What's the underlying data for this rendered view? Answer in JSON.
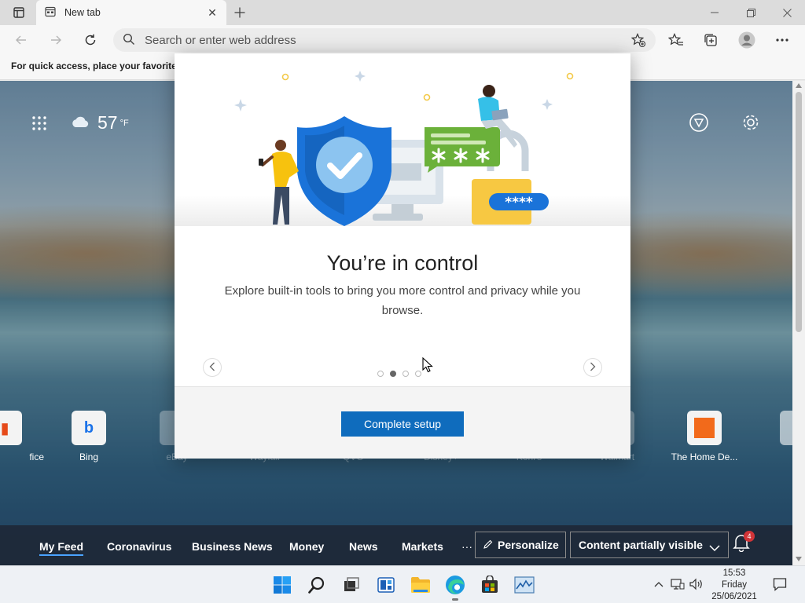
{
  "tab": {
    "title": "New tab"
  },
  "address": {
    "placeholder": "Search or enter web address"
  },
  "favorites_bar": {
    "text": "For quick access, place your favorites h"
  },
  "ntp": {
    "weather": {
      "temp": "57",
      "unit": "°F"
    },
    "quick_links": [
      {
        "label": "fice",
        "icon": "office-icon"
      },
      {
        "label": "Bing",
        "icon": "bing-icon"
      },
      {
        "label": "eBay",
        "icon": "ebay-icon"
      },
      {
        "label": "Wayfair",
        "icon": "wayfair-icon"
      },
      {
        "label": "QVC",
        "icon": "qvc-icon"
      },
      {
        "label": "Disney+",
        "icon": "disney-icon"
      },
      {
        "label": "Kohl's",
        "icon": "kohls-icon"
      },
      {
        "label": "Walmart",
        "icon": "walmart-icon"
      },
      {
        "label": "The Home De...",
        "icon": "home-depot-icon"
      }
    ],
    "news_tabs": [
      "My Feed",
      "Coronavirus",
      "Business News",
      "Money",
      "News",
      "Markets"
    ],
    "more": "···",
    "personalize": "Personalize",
    "content_visibility": "Content partially visible",
    "notification_count": "4"
  },
  "modal": {
    "illustration_password": "****",
    "heading": "You’re in control",
    "description": "Explore built-in tools to bring you more control and privacy while you browse.",
    "carousel": {
      "total": 4,
      "active": 1
    },
    "button": "Complete setup"
  },
  "taskbar": {
    "time": "15:53",
    "day": "Friday",
    "date": "25/06/2021"
  },
  "colors": {
    "accent": "#0f6cbd",
    "shield": "#1a73d9",
    "lock": "#f7c842",
    "chat": "#6bb13a"
  }
}
